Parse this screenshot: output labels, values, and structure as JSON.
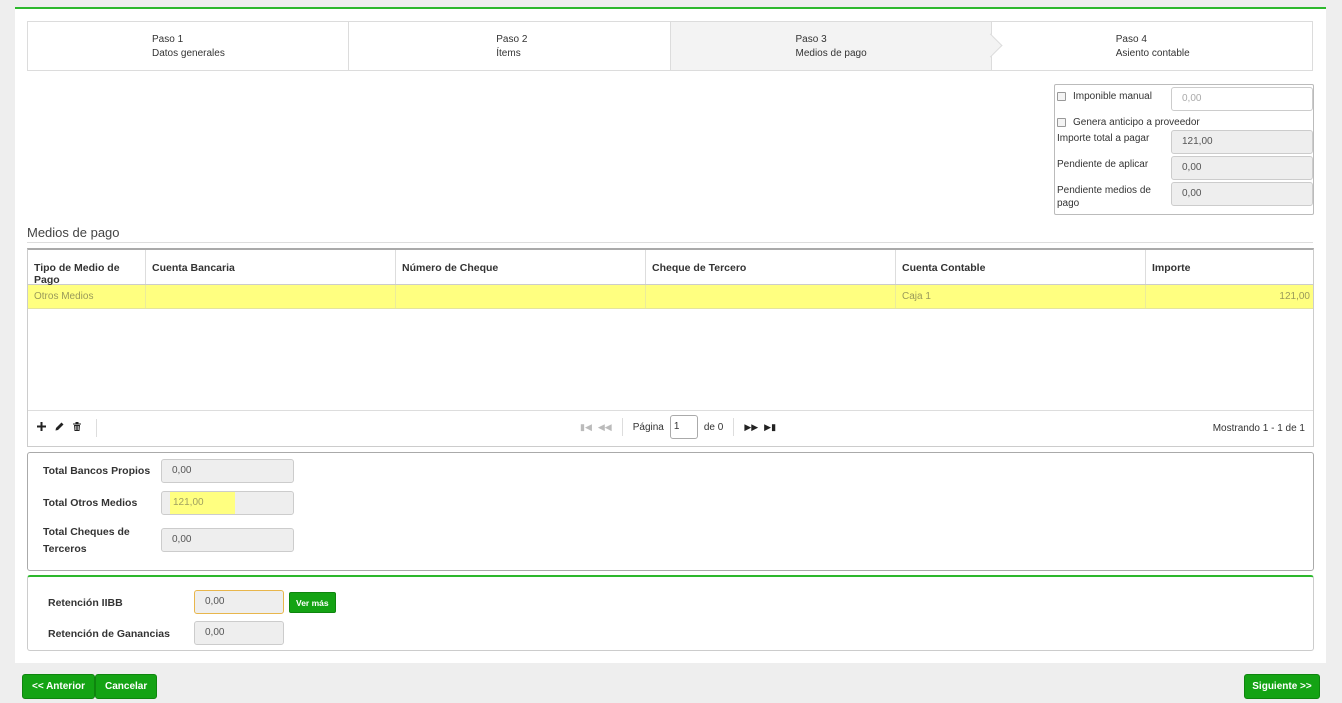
{
  "wizard": {
    "steps": [
      {
        "title": "Paso 1",
        "subtitle": "Datos generales"
      },
      {
        "title": "Paso 2",
        "subtitle": "Ítems"
      },
      {
        "title": "Paso 3",
        "subtitle": "Medios de pago"
      },
      {
        "title": "Paso 4",
        "subtitle": "Asiento contable"
      }
    ],
    "active_step": 3
  },
  "summary": {
    "imponible_manual_label": "Imponible manual",
    "imponible_manual_value": "0,00",
    "genera_anticipo_label": "Genera anticipo a proveedor",
    "importe_total_label": "Importe total a pagar",
    "importe_total_value": "121,00",
    "pendiente_aplicar_label": "Pendiente de aplicar",
    "pendiente_aplicar_value": "0,00",
    "pendiente_medios_label": "Pendiente medios de pago",
    "pendiente_medios_value": "0,00"
  },
  "medios": {
    "title": "Medios de pago",
    "columns": [
      "Tipo de Medio de Pago",
      "Cuenta Bancaria",
      "Número de Cheque",
      "Cheque de Tercero",
      "Cuenta Contable",
      "Importe"
    ],
    "rows": [
      [
        "Otros Medios",
        "",
        "",
        "",
        "Caja 1",
        "121,00"
      ]
    ],
    "pager": {
      "page_label": "Página",
      "page_value": "1",
      "of_label": "de 0",
      "count_text": "Mostrando 1 - 1 de 1"
    }
  },
  "totals": {
    "bancos_label": "Total Bancos Propios",
    "bancos_value": "0,00",
    "otros_label": "Total Otros Medios",
    "otros_value": "121,00",
    "cheques_label": "Total Cheques de Terceros",
    "cheques_value": "0,00"
  },
  "retenciones": {
    "iibb_label": "Retención IIBB",
    "iibb_value": "0,00",
    "ver_mas_label": "Ver más",
    "ganancias_label": "Retención de Ganancias",
    "ganancias_value": "0,00"
  },
  "footer": {
    "anterior_label": "<< Anterior",
    "cancelar_label": "Cancelar",
    "siguiente_label": "Siguiente >>"
  },
  "colors": {
    "accent_green": "#14a314",
    "highlight_yellow": "#ffff80"
  }
}
